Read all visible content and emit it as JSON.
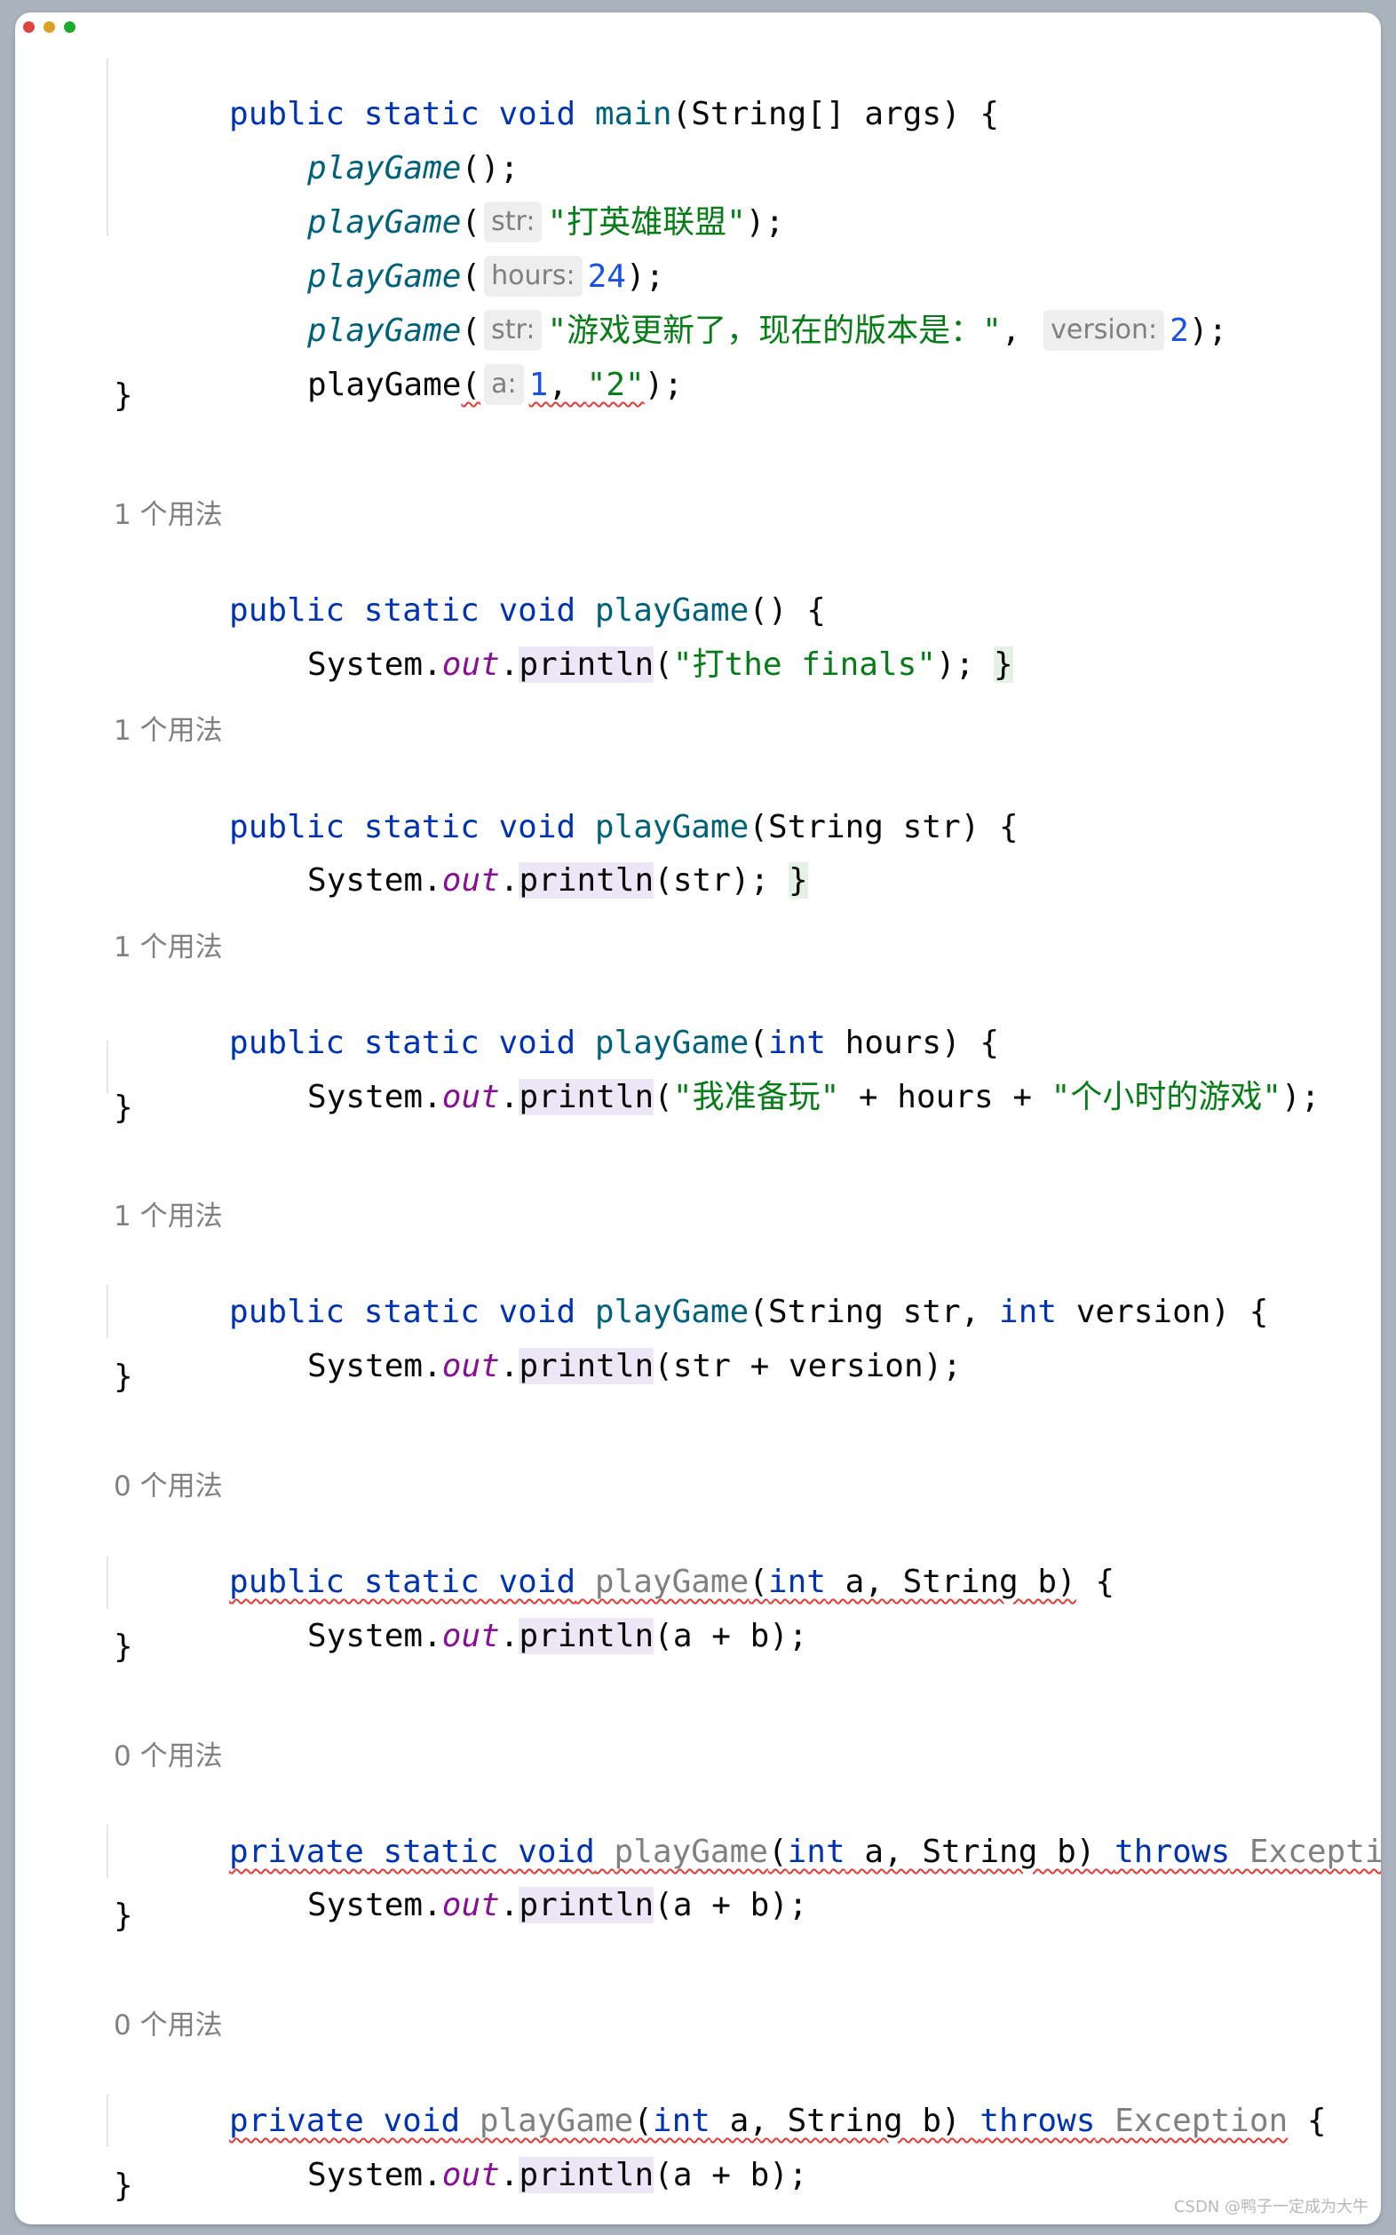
{
  "window_controls": {
    "close_color": "#e0443e",
    "minimize_color": "#dea123",
    "zoom_color": "#1aab29"
  },
  "colors": {
    "keyword": "#0033b3",
    "method": "#00627a",
    "string": "#067d17",
    "number": "#1750eb",
    "static_field": "#871094",
    "unused_method": "#808080",
    "error_underline": "#e53935",
    "inlay_hint_bg": "#eeeeef"
  },
  "code": {
    "main_sig": {
      "kw": "public static void",
      "name": "main",
      "params": "(String[] args) {"
    },
    "call1": {
      "name": "playGame",
      "rest": "();"
    },
    "call2": {
      "name": "playGame",
      "open": "(",
      "hint": "str:",
      "arg": "\"打英雄联盟\"",
      "close": ");"
    },
    "call3": {
      "name": "playGame",
      "open": "(",
      "hint": "hours:",
      "arg": "24",
      "close": ");"
    },
    "call4": {
      "name": "playGame",
      "open": "(",
      "hint1": "str:",
      "arg1": "\"游戏更新了，现在的版本是：\"",
      "sep": ", ",
      "hint2": "version:",
      "arg2": "2",
      "close": ");"
    },
    "call5": {
      "name": "playGame",
      "open": "(",
      "hint": "a:",
      "arg1": "1",
      "sep": ", ",
      "arg2": "\"2\"",
      "close": ");"
    },
    "close_brace": "}",
    "m1": {
      "usage": "1 个用法",
      "kw": "public static void",
      "name": "playGame",
      "params": "() {",
      "body_sys": "System.",
      "body_out": "out",
      "body_dot": ".",
      "body_println": "println",
      "body_arg_open": "(",
      "body_str": "\"打the finals\"",
      "body_end": ");",
      "fold_brace": "}"
    },
    "m2": {
      "usage": "1 个用法",
      "kw": "public static void",
      "name": "playGame",
      "params": "(String str) {",
      "body_sys": "System.",
      "body_out": "out",
      "body_dot": ".",
      "body_println": "println",
      "body_rest": "(str);",
      "fold_brace": "}"
    },
    "m3": {
      "usage": "1 个用法",
      "kw": "public static void",
      "name": "playGame",
      "p_open": "(",
      "p_int": "int",
      "p_rest": " hours) {",
      "body_sys": "System.",
      "body_out": "out",
      "body_dot": ".",
      "body_println": "println",
      "body_open": "(",
      "body_str1": "\"我准备玩\"",
      "body_mid": " + hours + ",
      "body_str2": "\"个小时的游戏\"",
      "body_end": ");",
      "close": "}"
    },
    "m4": {
      "usage": "1 个用法",
      "kw": "public static void",
      "name": "playGame",
      "p_open": "(String str, ",
      "p_int": "int",
      "p_rest": " version) {",
      "body_sys": "System.",
      "body_out": "out",
      "body_dot": ".",
      "body_println": "println",
      "body_rest": "(str + version);",
      "close": "}"
    },
    "m5": {
      "usage": "0 个用法",
      "kw": "public static void",
      "name": "playGame",
      "p_open": "(",
      "p_int": "int",
      "p_rest": " a, String b)",
      "brace": " {",
      "body_sys": "System.",
      "body_out": "out",
      "body_dot": ".",
      "body_println": "println",
      "body_rest": "(a + b);",
      "close": "}"
    },
    "m6": {
      "usage": "0 个用法",
      "kw": "private static void",
      "name": "playGame",
      "p_open": "(",
      "p_int": "int",
      "p_rest": " a, String b) ",
      "throws": "throws",
      "exc": "Exception",
      "brace": " {",
      "body_sys": "System.",
      "body_out": "out",
      "body_dot": ".",
      "body_println": "println",
      "body_rest": "(a + b);",
      "close": "}"
    },
    "m7": {
      "usage": "0 个用法",
      "kw": "private void",
      "name": "playGame",
      "p_open": "(",
      "p_int": "int",
      "p_rest": " a, String b) ",
      "throws": "throws",
      "exc": "Exception",
      "brace": " {",
      "body_sys": "System.",
      "body_out": "out",
      "body_dot": ".",
      "body_println": "println",
      "body_rest": "(a + b);",
      "close": "}"
    }
  },
  "watermark": "CSDN @鸭子一定成为大牛"
}
